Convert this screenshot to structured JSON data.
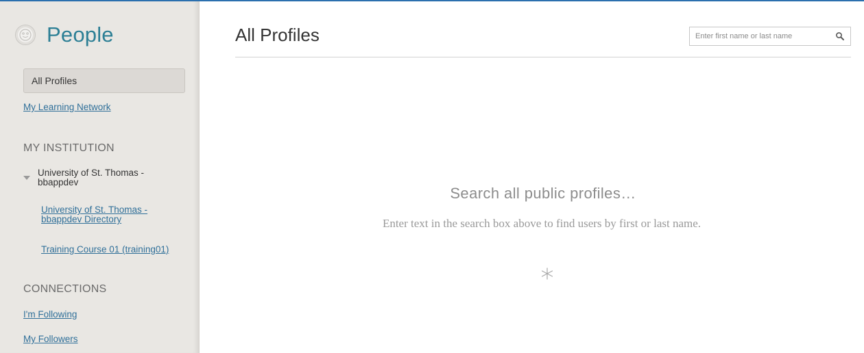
{
  "sidebar": {
    "title": "People",
    "items": [
      {
        "label": "All Profiles"
      },
      {
        "label": "My Learning Network"
      }
    ],
    "institution": {
      "heading": "MY INSTITUTION",
      "tree_label": "University of St. Thomas - bbappdev",
      "links": [
        {
          "label": "University of St. Thomas - bbappdev Directory"
        },
        {
          "label": "Training Course 01 (training01)"
        }
      ]
    },
    "connections": {
      "heading": "CONNECTIONS",
      "links": [
        {
          "label": "I'm Following"
        },
        {
          "label": "My Followers"
        }
      ]
    }
  },
  "main": {
    "title": "All Profiles",
    "search": {
      "placeholder": "Enter first name or last name",
      "value": ""
    },
    "empty_state": {
      "title": "Search all public profiles…",
      "description": "Enter text in the search box above to find users by first or last name."
    }
  },
  "colors": {
    "accent": "#2c7f95",
    "link": "#2f6f99",
    "sidebar_bg": "#e9e7e3",
    "top_rule": "#2a6fae"
  },
  "icons": {
    "logo": "smiley-face-icon",
    "search": "magnifier-icon",
    "tree": "caret-down-icon",
    "empty": "asterisk-icon"
  }
}
